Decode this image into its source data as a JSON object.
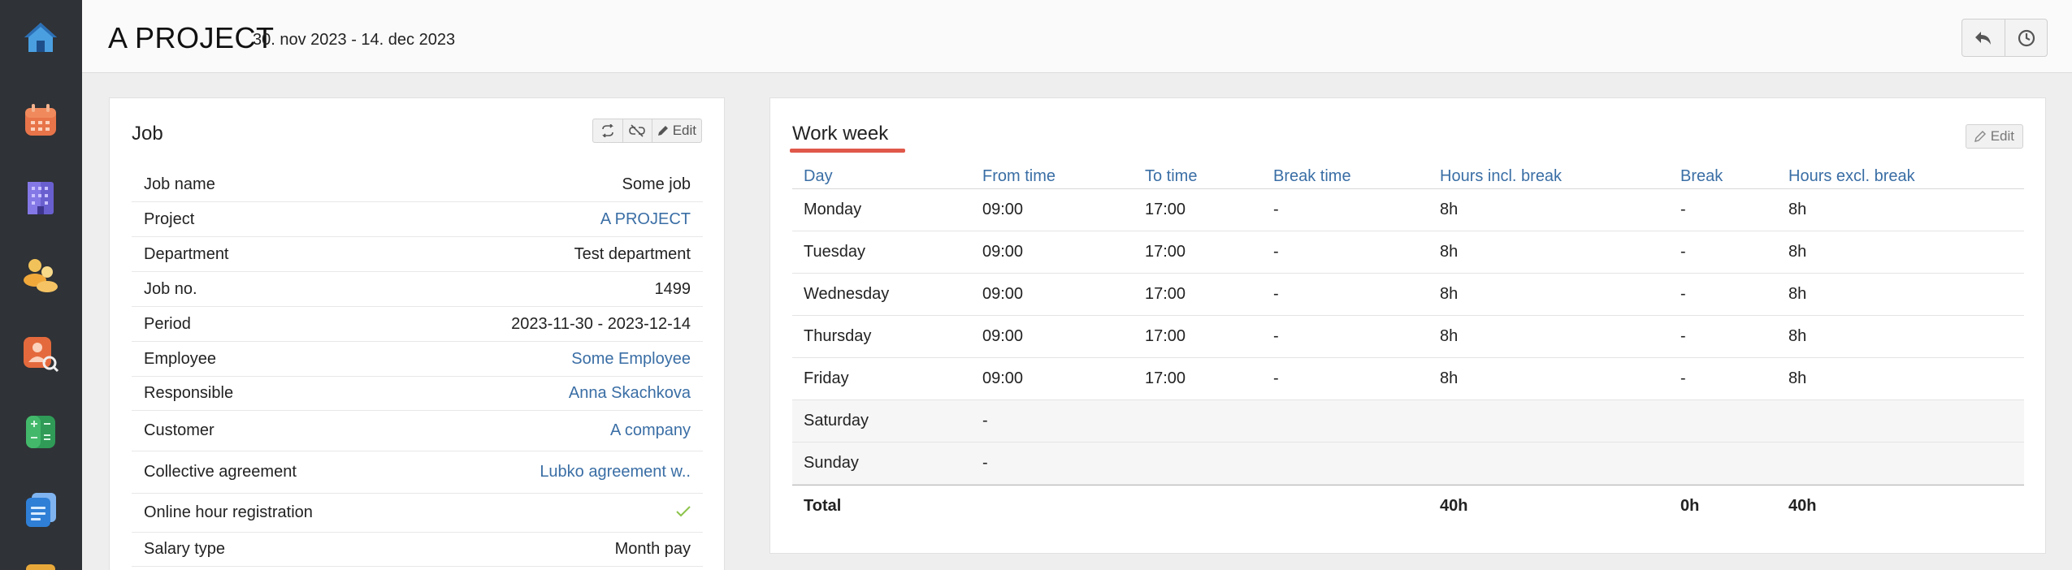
{
  "header": {
    "title": "A PROJECT",
    "period": "30. nov 2023 - 14. dec 2023"
  },
  "sidebar": {
    "items": [
      {
        "icon": "home-icon"
      },
      {
        "icon": "calendar-icon"
      },
      {
        "icon": "building-icon"
      },
      {
        "icon": "users-icon"
      },
      {
        "icon": "user-search-icon"
      },
      {
        "icon": "calculator-icon"
      },
      {
        "icon": "documents-icon"
      }
    ]
  },
  "job": {
    "title": "Job",
    "edit_label": "Edit",
    "rows": [
      {
        "label": "Job name",
        "value": "Some job",
        "link": false
      },
      {
        "label": "Project",
        "value": "A PROJECT",
        "link": true
      },
      {
        "label": "Department",
        "value": "Test department",
        "link": false
      },
      {
        "label": "Job no.",
        "value": "1499",
        "link": false
      },
      {
        "label": "Period",
        "value": "2023-11-30 - 2023-12-14",
        "link": false
      },
      {
        "label": "Employee",
        "value": "Some Employee",
        "link": true
      },
      {
        "label": "Responsible",
        "value": "Anna Skachkova",
        "link": true
      },
      {
        "label": "Customer",
        "value": "A company",
        "link": true
      },
      {
        "label": "Collective agreement",
        "value": "Lubko agreement w..",
        "link": true
      },
      {
        "label": "Online hour registration",
        "value": "",
        "link": false,
        "check": true
      },
      {
        "label": "Salary type",
        "value": "Month pay",
        "link": false
      }
    ]
  },
  "work_week": {
    "title": "Work week",
    "edit_label": "Edit",
    "columns": [
      "Day",
      "From time",
      "To time",
      "Break time",
      "Hours incl. break",
      "Break",
      "Hours excl. break"
    ],
    "rows": [
      [
        "Monday",
        "09:00",
        "17:00",
        "-",
        "8h",
        "-",
        "8h"
      ],
      [
        "Tuesday",
        "09:00",
        "17:00",
        "-",
        "8h",
        "-",
        "8h"
      ],
      [
        "Wednesday",
        "09:00",
        "17:00",
        "-",
        "8h",
        "-",
        "8h"
      ],
      [
        "Thursday",
        "09:00",
        "17:00",
        "-",
        "8h",
        "-",
        "8h"
      ],
      [
        "Friday",
        "09:00",
        "17:00",
        "-",
        "8h",
        "-",
        "8h"
      ],
      [
        "Saturday",
        "-",
        "",
        "",
        "",
        "",
        ""
      ],
      [
        "Sunday",
        "-",
        "",
        "",
        "",
        "",
        ""
      ]
    ],
    "total": [
      "Total",
      "",
      "",
      "",
      "40h",
      "0h",
      "40h"
    ]
  }
}
